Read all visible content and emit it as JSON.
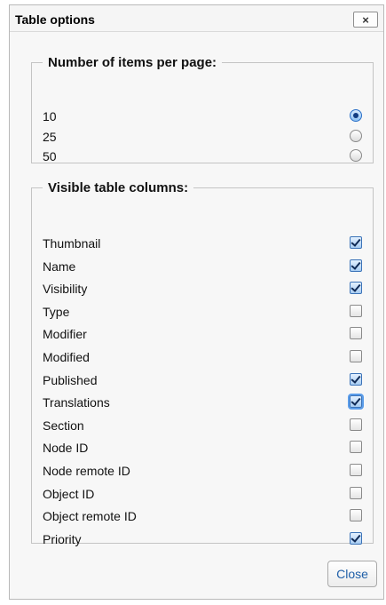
{
  "dialog": {
    "title": "Table options",
    "close_icon": "close-icon",
    "close_glyph": "×",
    "close_button_label": "Close"
  },
  "items_per_page": {
    "legend": "Number of items per page:",
    "options": [
      {
        "label": "10",
        "selected": true
      },
      {
        "label": "25",
        "selected": false
      },
      {
        "label": "50",
        "selected": false
      }
    ]
  },
  "visible_columns": {
    "legend": "Visible table columns:",
    "columns": [
      {
        "label": "Thumbnail",
        "checked": true
      },
      {
        "label": "Name",
        "checked": true
      },
      {
        "label": "Visibility",
        "checked": true
      },
      {
        "label": "Type",
        "checked": false
      },
      {
        "label": "Modifier",
        "checked": false
      },
      {
        "label": "Modified",
        "checked": false
      },
      {
        "label": "Published",
        "checked": true
      },
      {
        "label": "Translations",
        "checked": true
      },
      {
        "label": "Section",
        "checked": false
      },
      {
        "label": "Node ID",
        "checked": false
      },
      {
        "label": "Node remote ID",
        "checked": false
      },
      {
        "label": "Object ID",
        "checked": false
      },
      {
        "label": "Object remote ID",
        "checked": false
      },
      {
        "label": "Priority",
        "checked": true
      }
    ]
  },
  "colors": {
    "accent": "#2a6fc7",
    "close_text": "#1f5fa8"
  }
}
